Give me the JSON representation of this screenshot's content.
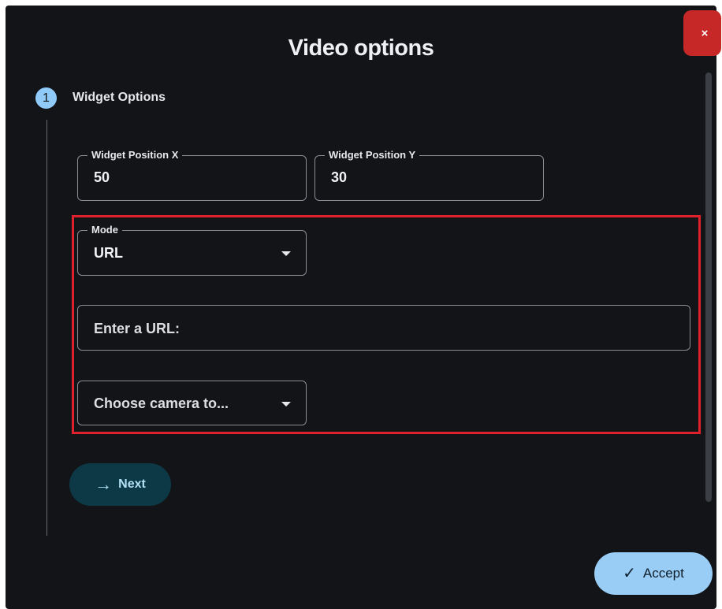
{
  "dialog": {
    "title": "Video options",
    "close_icon": "close-icon",
    "close_label": "×"
  },
  "stepper": {
    "step_number": "1",
    "step_label": "Widget Options"
  },
  "fields": {
    "position_x": {
      "label": "Widget Position X",
      "value": "50"
    },
    "position_y": {
      "label": "Widget Position Y",
      "value": "30"
    },
    "mode": {
      "label": "Mode",
      "value": "URL"
    },
    "url": {
      "placeholder": "Enter a URL:"
    },
    "camera": {
      "placeholder": "Choose camera to..."
    }
  },
  "buttons": {
    "next_label": "Next",
    "next_icon": "arrow-right-icon",
    "accept_label": "Accept",
    "accept_icon": "check-icon"
  },
  "colors": {
    "background": "#121418",
    "accent": "#90caf9",
    "close": "#c62828",
    "highlight": "#e0202a"
  }
}
